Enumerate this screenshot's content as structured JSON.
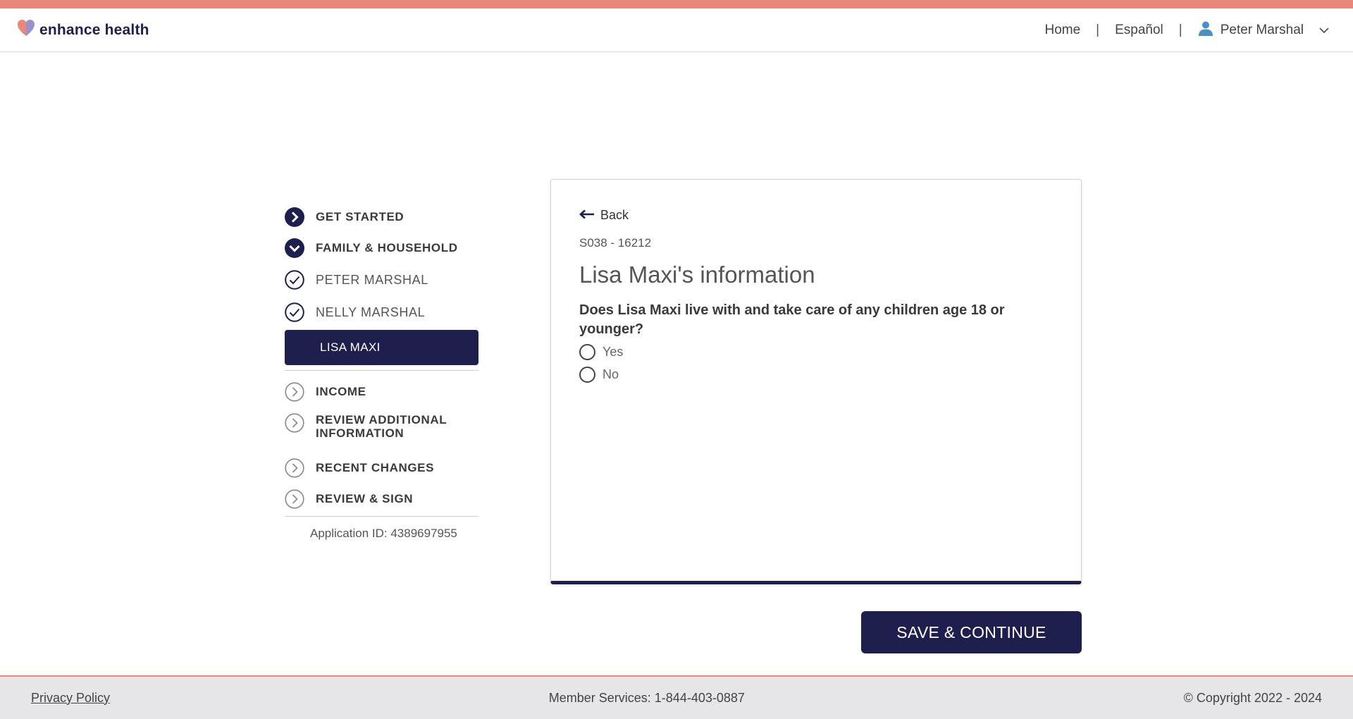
{
  "header": {
    "logo_text": "enhance health",
    "nav": {
      "home": "Home",
      "language": "Español",
      "user_name": "Peter Marshal"
    }
  },
  "sidebar": {
    "steps": [
      {
        "label": "GET STARTED",
        "state": "current"
      },
      {
        "label": "FAMILY & HOUSEHOLD",
        "state": "expanded"
      },
      {
        "label": "PETER MARSHAL",
        "state": "complete"
      },
      {
        "label": "NELLY MARSHAL",
        "state": "complete"
      },
      {
        "label": "LISA MAXI",
        "state": "active"
      },
      {
        "label": "INCOME",
        "state": "pending"
      },
      {
        "label": "REVIEW ADDITIONAL INFORMATION",
        "state": "pending"
      },
      {
        "label": "RECENT CHANGES",
        "state": "pending"
      },
      {
        "label": "REVIEW & SIGN",
        "state": "pending"
      }
    ],
    "application_id": "Application ID: 4389697955"
  },
  "main": {
    "back_label": "Back",
    "code": "S038 - 16212",
    "title": "Lisa Maxi's information",
    "question": "Does Lisa Maxi live with and take care of any children age 18 or younger?",
    "options": [
      "Yes",
      "No"
    ]
  },
  "actions": {
    "save_label": "SAVE & CONTINUE"
  },
  "footer": {
    "privacy": "Privacy Policy",
    "member_services": "Member Services: 1-844-403-0887",
    "copyright": "© Copyright 2022 - 2024"
  },
  "colors": {
    "brand_navy": "#1f1f4d",
    "accent_coral": "#e8877a",
    "user_icon": "#4a90c2"
  }
}
